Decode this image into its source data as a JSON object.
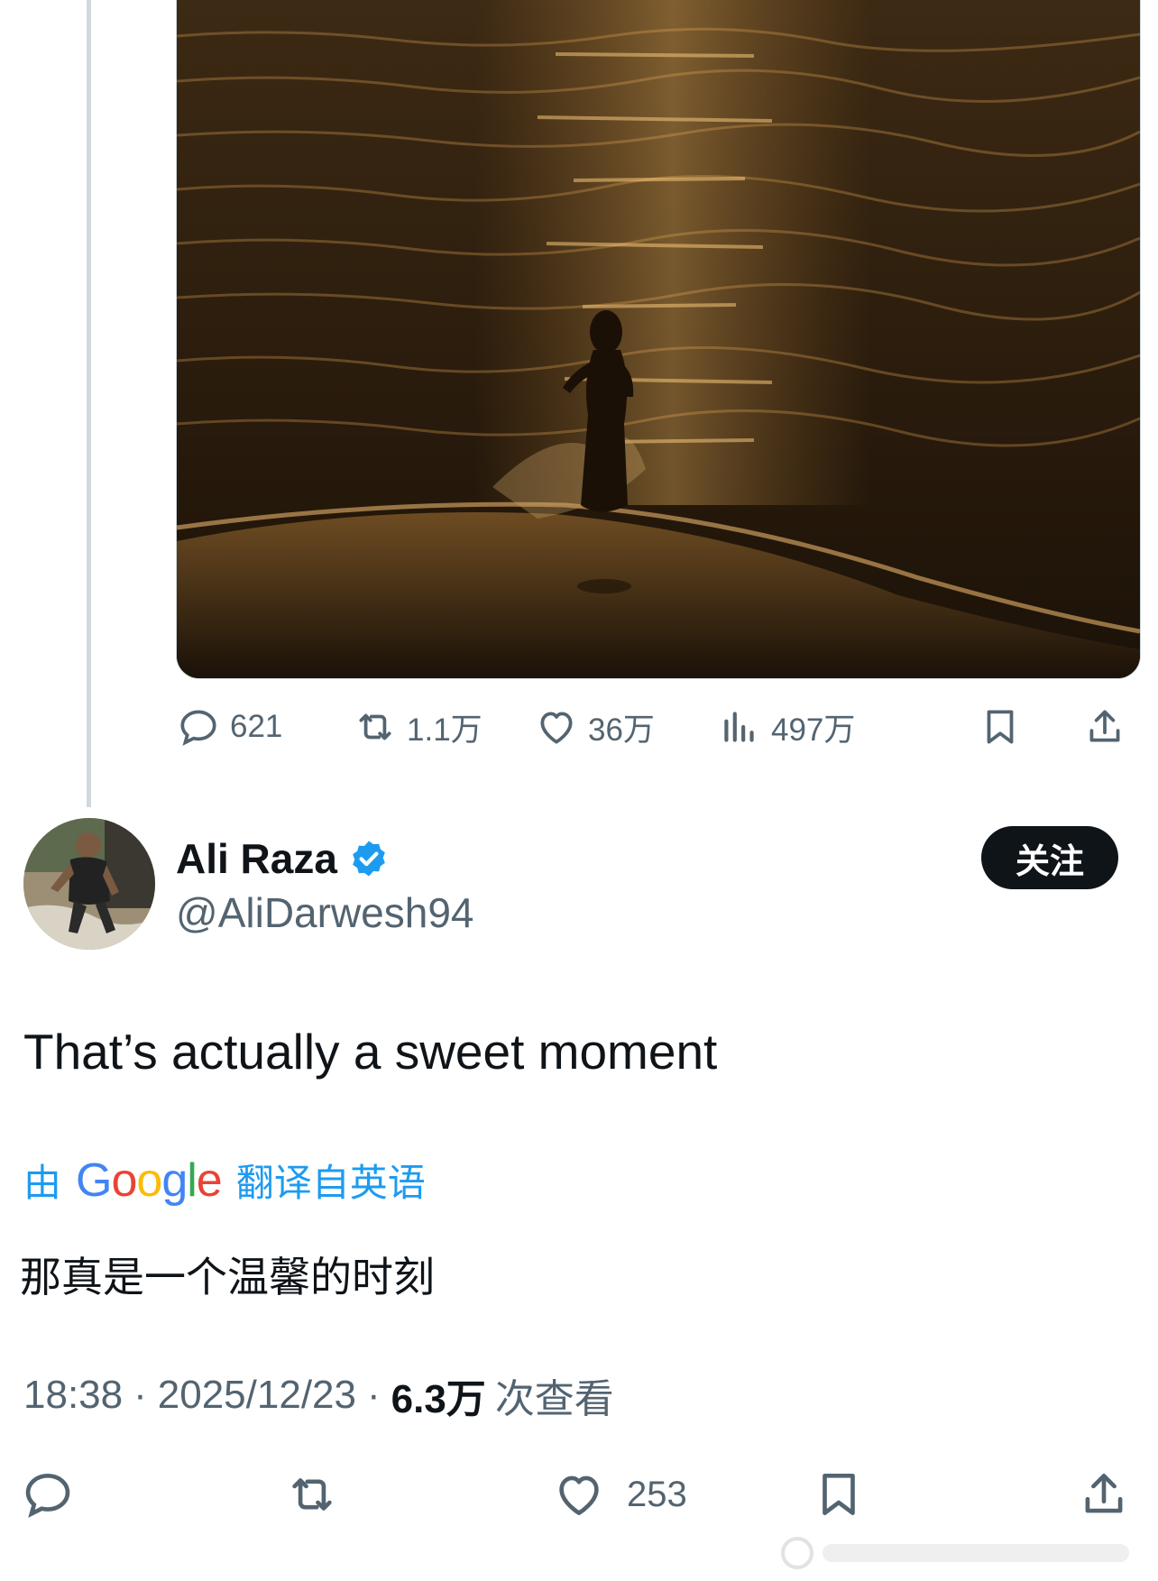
{
  "previous_tweet": {
    "stats": {
      "replies": "621",
      "reposts": "1.1万",
      "likes": "36万",
      "views": "497万"
    },
    "icons": [
      "reply-icon",
      "repost-icon",
      "like-icon",
      "views-icon",
      "bookmark-icon",
      "share-icon"
    ]
  },
  "tweet": {
    "display_name": "Ali Raza",
    "handle": "@AliDarwesh94",
    "follow_label": "关注",
    "text": "That’s actually a sweet moment",
    "translation": {
      "prefix": "由",
      "brand": "Google",
      "suffix": "翻译自英语",
      "text": "那真是一个温馨的时刻"
    },
    "meta": {
      "time": "18:38",
      "separator": "·",
      "date": "2025/12/23",
      "views_count": "6.3万",
      "views_label": "次查看"
    },
    "stats": {
      "likes": "253"
    }
  },
  "colors": {
    "text_primary": "#0f1419",
    "text_secondary": "#536471",
    "accent_blue": "#1d9bf0",
    "thread_line": "#cfd9de"
  }
}
